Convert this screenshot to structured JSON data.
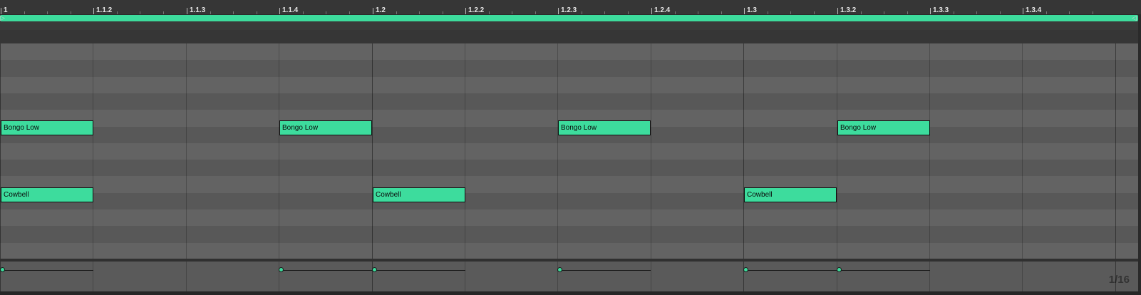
{
  "colors": {
    "note": "#3ddc9d",
    "accent": "#3ddc9d"
  },
  "ruler": {
    "labels": [
      "1",
      "1.1.2",
      "1.1.3",
      "1.1.4",
      "1.2",
      "1.2.2",
      "1.2.3",
      "1.2.4",
      "1.3",
      "1.3.2",
      "1.3.3",
      "1.3.4"
    ]
  },
  "loop": {
    "start_marker_icon": "loop-start-icon",
    "end_marker_icon": "loop-end-icon"
  },
  "notes": [
    {
      "label": "Bongo Low",
      "row": "bongo",
      "step": 0
    },
    {
      "label": "Bongo Low",
      "row": "bongo",
      "step": 3
    },
    {
      "label": "Bongo Low",
      "row": "bongo",
      "step": 6
    },
    {
      "label": "Bongo Low",
      "row": "bongo",
      "step": 9
    },
    {
      "label": "Cowbell",
      "row": "cowbell",
      "step": 0
    },
    {
      "label": "Cowbell",
      "row": "cowbell",
      "step": 4
    },
    {
      "label": "Cowbell",
      "row": "cowbell",
      "step": 8
    }
  ],
  "velocity": {
    "steps": [
      0,
      3,
      4,
      6,
      8,
      9
    ]
  },
  "grid": {
    "resolution": "1/16"
  }
}
